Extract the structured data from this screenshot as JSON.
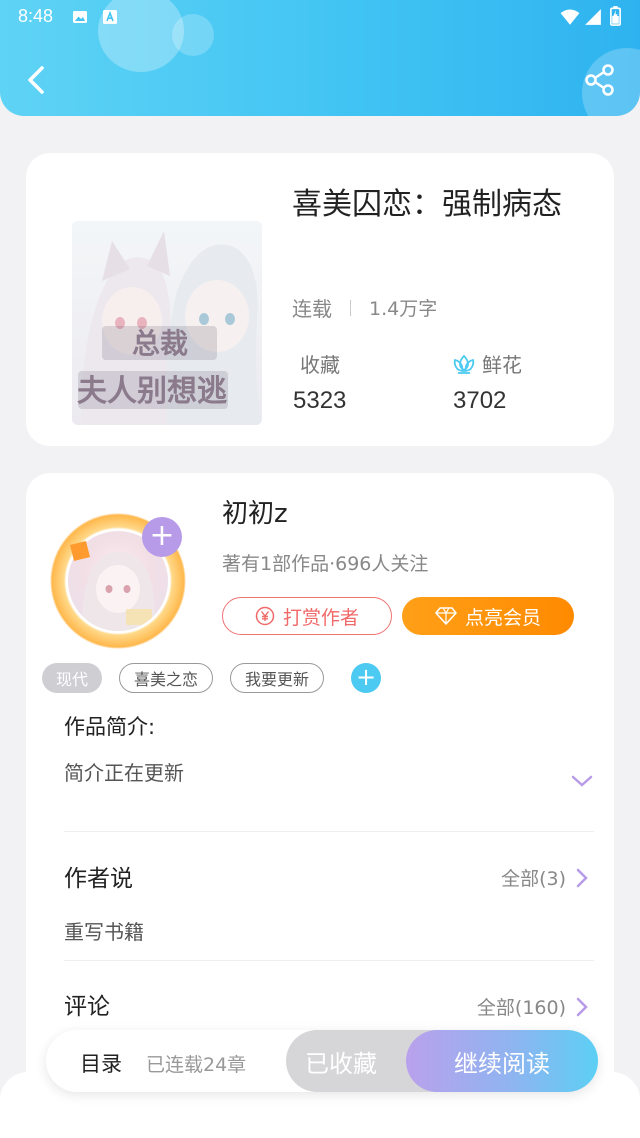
{
  "status_bar": {
    "time": "8:48"
  },
  "book": {
    "title": "喜美囚恋：强制病态",
    "status": "连载",
    "word_count": "1.4万字",
    "favorites_label": "收藏",
    "favorites_value": "5323",
    "flowers_label": "鲜花",
    "flowers_value": "3702",
    "cover_text": "总裁夫人别想逃"
  },
  "author": {
    "name": "初初z",
    "meta": "著有1部作品·696人关注",
    "tip_label": "打赏作者",
    "vip_label": "点亮会员"
  },
  "tags": [
    "现代",
    "喜美之恋",
    "我要更新"
  ],
  "intro": {
    "title": "作品简介:",
    "text": "简介正在更新"
  },
  "author_says": {
    "title": "作者说",
    "more": "全部(3)",
    "text": "重写书籍"
  },
  "comments": {
    "title": "评论",
    "more": "全部(160)"
  },
  "bottom": {
    "toc_label": "目录",
    "toc_sub": "已连载24章",
    "collected_label": "已收藏",
    "read_label": "继续阅读"
  },
  "colors": {
    "header": "#41c4f3",
    "vip": "#ff9410",
    "tip": "#f06a6a",
    "accent_blue": "#4ccaf2",
    "purple": "#b79be8"
  },
  "icons": [
    "back-arrow-icon",
    "share-icon",
    "flower-icon",
    "yen-icon",
    "diamond-icon",
    "plus-icon",
    "chevron-down-icon",
    "chevron-right-icon"
  ]
}
